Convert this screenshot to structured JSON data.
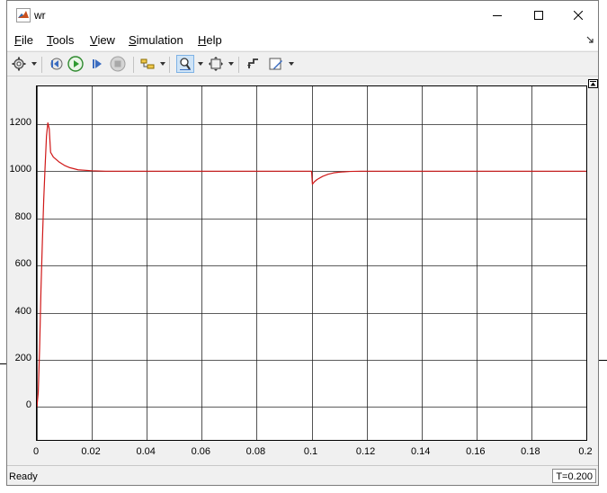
{
  "window": {
    "title": "wr"
  },
  "menu": {
    "items": [
      {
        "label": "File",
        "accel": "F",
        "rest": "ile"
      },
      {
        "label": "Tools",
        "accel": "T",
        "rest": "ools"
      },
      {
        "label": "View",
        "accel": "V",
        "rest": "iew"
      },
      {
        "label": "Simulation",
        "accel": "S",
        "rest": "imulation"
      },
      {
        "label": "Help",
        "accel": "H",
        "rest": "elp"
      }
    ]
  },
  "toolbar": {
    "icons": [
      "gear-icon",
      "step-back-icon",
      "run-icon",
      "step-forward-icon",
      "stop-icon",
      "layout-icon",
      "zoom-icon",
      "fit-icon",
      "triggers-icon",
      "style-icon"
    ]
  },
  "status": {
    "text": "Ready",
    "time": "T=0.200"
  },
  "colors": {
    "trace": "#d01818",
    "grid": "#262626",
    "plot_background": "#ffffff",
    "figure_background": "#f0f0f0"
  },
  "chart_data": {
    "type": "line",
    "title": "",
    "xlabel": "",
    "ylabel": "",
    "xlim": [
      0,
      0.2
    ],
    "ylim": [
      -140,
      1360
    ],
    "grid": true,
    "xticks": [
      "0",
      "0.02",
      "0.04",
      "0.06",
      "0.08",
      "0.1",
      "0.12",
      "0.14",
      "0.16",
      "0.18",
      "0.2"
    ],
    "xtick_values": [
      0,
      0.02,
      0.04,
      0.06,
      0.08,
      0.1,
      0.12,
      0.14,
      0.16,
      0.18,
      0.2
    ],
    "yticks": [
      "0",
      "200",
      "400",
      "600",
      "800",
      "1000",
      "1200"
    ],
    "ytick_values": [
      0,
      200,
      400,
      600,
      800,
      1000,
      1200
    ],
    "series": [
      {
        "x": [
          0,
          0.0005,
          0.001,
          0.0015,
          0.002,
          0.0025,
          0.003,
          0.0035,
          0.004,
          0.0045,
          0.005,
          0.006,
          0.007,
          0.008,
          0.01,
          0.012,
          0.015,
          0.02,
          0.025,
          0.03,
          0.05,
          0.08,
          0.1,
          0.1003,
          0.101,
          0.102,
          0.104,
          0.106,
          0.108,
          0.11,
          0.114,
          0.118,
          0.125,
          0.15,
          0.2
        ],
        "y": [
          0,
          60,
          250,
          500,
          700,
          880,
          1020,
          1150,
          1205,
          1180,
          1080,
          1060,
          1050,
          1040,
          1025,
          1015,
          1006,
          1002,
          1000,
          1000,
          1000,
          1000,
          1000,
          945,
          955,
          965,
          978,
          987,
          993,
          996,
          999,
          1000,
          1000,
          1000,
          1000
        ]
      }
    ]
  }
}
